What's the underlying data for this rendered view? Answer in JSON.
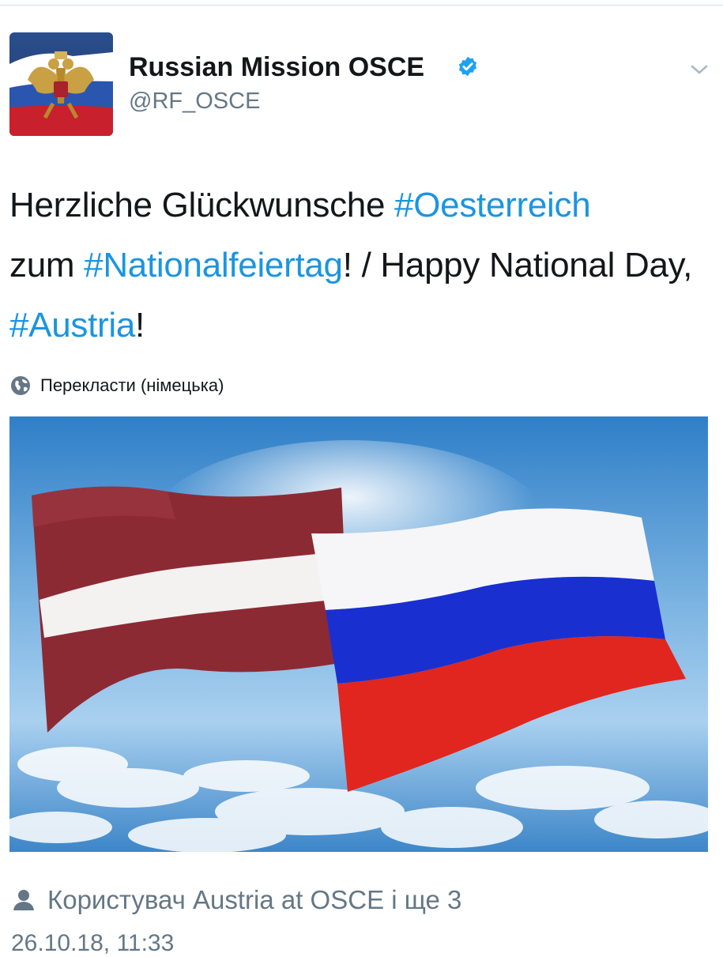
{
  "tweet": {
    "display_name": "Russian Mission OSCE",
    "handle": "@RF_OSCE",
    "verified_icon": "verified-badge-icon",
    "more_icon": "chevron-down-icon",
    "text": {
      "t1": "Herzliche Glückwunsche ",
      "h1": "#Oesterreich",
      "t2": "zum ",
      "h2": "#Nationalfeiertag",
      "t3": "! / Happy National Day, ",
      "h3": "#Austria",
      "t4": "!"
    },
    "translate_label": "Перекласти (німецька)",
    "tagged_users": "Користувач Austria at OSCE і ще 3",
    "timestamp": "26.10.18, 11:33",
    "colors": {
      "hashtag": "#1b95e0",
      "secondary_text": "#657786",
      "verified": "#1da1f2"
    }
  }
}
